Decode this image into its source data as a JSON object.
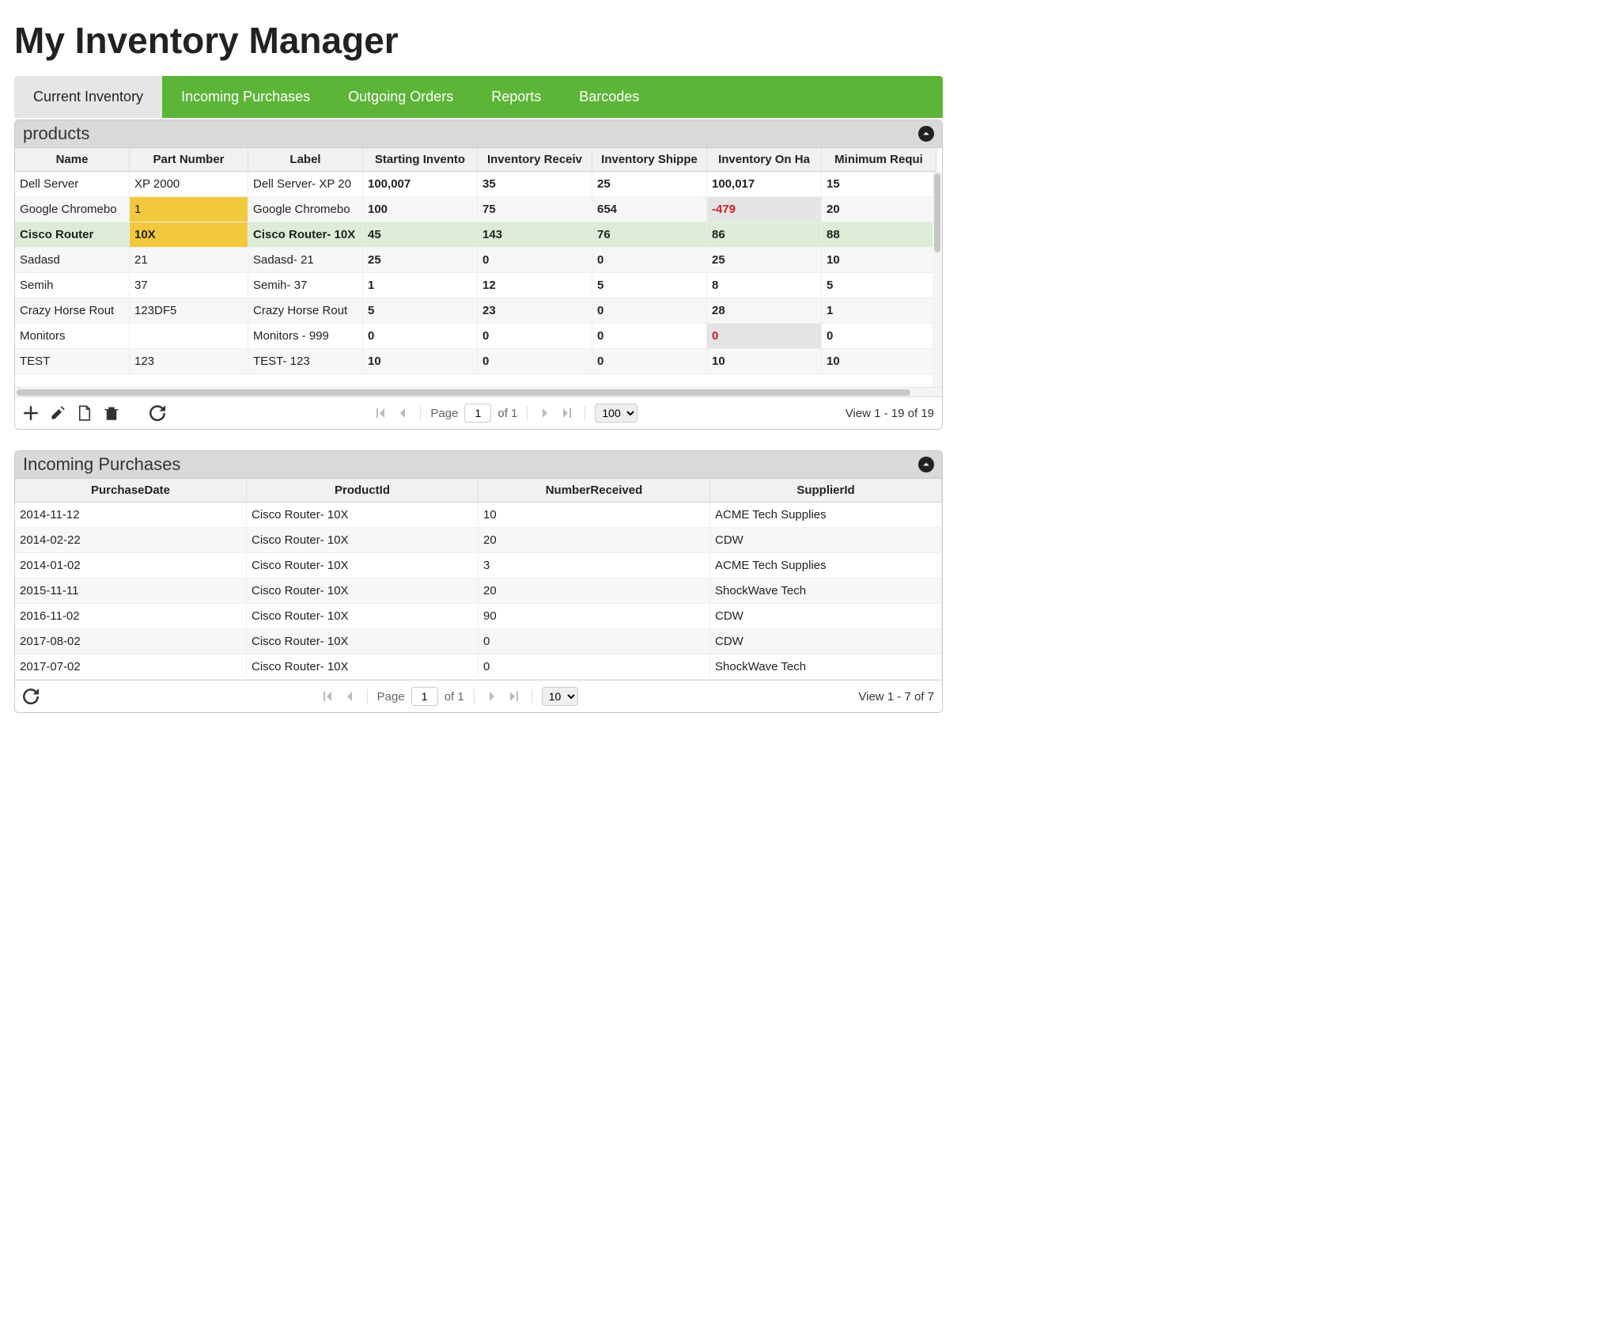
{
  "page_title": "My Inventory Manager",
  "tabs": [
    {
      "label": "Current Inventory",
      "active": true
    },
    {
      "label": "Incoming Purchases",
      "active": false
    },
    {
      "label": "Outgoing Orders",
      "active": false
    },
    {
      "label": "Reports",
      "active": false
    },
    {
      "label": "Barcodes",
      "active": false
    }
  ],
  "products_grid": {
    "caption": "products",
    "columns": [
      "Name",
      "Part Number",
      "Label",
      "Starting Invento",
      "Inventory Receiv",
      "Inventory Shippe",
      "Inventory On Ha",
      "Minimum Requi"
    ],
    "rows": [
      {
        "name": "Dell Server",
        "part": "XP 2000",
        "label": "Dell Server- XP 20",
        "start": "100,007",
        "recv": "35",
        "ship": "25",
        "onhand": "100,017",
        "min": "15",
        "alt": false
      },
      {
        "name": "Google Chromebo",
        "part": "1",
        "label": "Google Chromebo",
        "start": "100",
        "recv": "75",
        "ship": "654",
        "onhand": "-479",
        "min": "20",
        "alt": true,
        "part_warn": true,
        "onhand_neg": true
      },
      {
        "name": "Cisco Router",
        "part": "10X",
        "label": "Cisco Router- 10X",
        "start": "45",
        "recv": "143",
        "ship": "76",
        "onhand": "86",
        "min": "88",
        "selected": true,
        "part_warn": true
      },
      {
        "name": "Sadasd",
        "part": "21",
        "label": "Sadasd- 21",
        "start": "25",
        "recv": "0",
        "ship": "0",
        "onhand": "25",
        "min": "10",
        "alt": true
      },
      {
        "name": "Semih",
        "part": "37",
        "label": "Semih- 37",
        "start": "1",
        "recv": "12",
        "ship": "5",
        "onhand": "8",
        "min": "5",
        "alt": false
      },
      {
        "name": "Crazy Horse Rout",
        "part": "123DF5",
        "label": "Crazy Horse Rout",
        "start": "5",
        "recv": "23",
        "ship": "0",
        "onhand": "28",
        "min": "1",
        "alt": true
      },
      {
        "name": "Monitors",
        "part": "",
        "label": "Monitors - 999",
        "start": "0",
        "recv": "0",
        "ship": "0",
        "onhand": "0",
        "min": "0",
        "alt": false,
        "onhand_zero": true
      },
      {
        "name": "TEST",
        "part": "123",
        "label": "TEST- 123",
        "start": "10",
        "recv": "0",
        "ship": "0",
        "onhand": "10",
        "min": "10",
        "alt": true
      }
    ],
    "pager": {
      "page_label": "Page",
      "page": "1",
      "of_label": "of 1",
      "page_size": "100",
      "view_text": "View 1 - 19 of 19"
    }
  },
  "purchases_grid": {
    "caption": "Incoming Purchases",
    "columns": [
      "PurchaseDate",
      "ProductId",
      "NumberReceived",
      "SupplierId"
    ],
    "rows": [
      {
        "date": "2014-11-12",
        "product": "Cisco Router- 10X",
        "num": "10",
        "supplier": "ACME Tech Supplies",
        "alt": false
      },
      {
        "date": "2014-02-22",
        "product": "Cisco Router- 10X",
        "num": "20",
        "supplier": "CDW",
        "alt": true
      },
      {
        "date": "2014-01-02",
        "product": "Cisco Router- 10X",
        "num": "3",
        "supplier": "ACME Tech Supplies",
        "alt": false
      },
      {
        "date": "2015-11-11",
        "product": "Cisco Router- 10X",
        "num": "20",
        "supplier": "ShockWave Tech",
        "alt": true
      },
      {
        "date": "2016-11-02",
        "product": "Cisco Router- 10X",
        "num": "90",
        "supplier": "CDW",
        "alt": false
      },
      {
        "date": "2017-08-02",
        "product": "Cisco Router- 10X",
        "num": "0",
        "supplier": "CDW",
        "alt": true
      },
      {
        "date": "2017-07-02",
        "product": "Cisco Router- 10X",
        "num": "0",
        "supplier": "ShockWave Tech",
        "alt": false
      }
    ],
    "pager": {
      "page_label": "Page",
      "page": "1",
      "of_label": "of 1",
      "page_size": "10",
      "view_text": "View 1 - 7 of 7"
    }
  }
}
